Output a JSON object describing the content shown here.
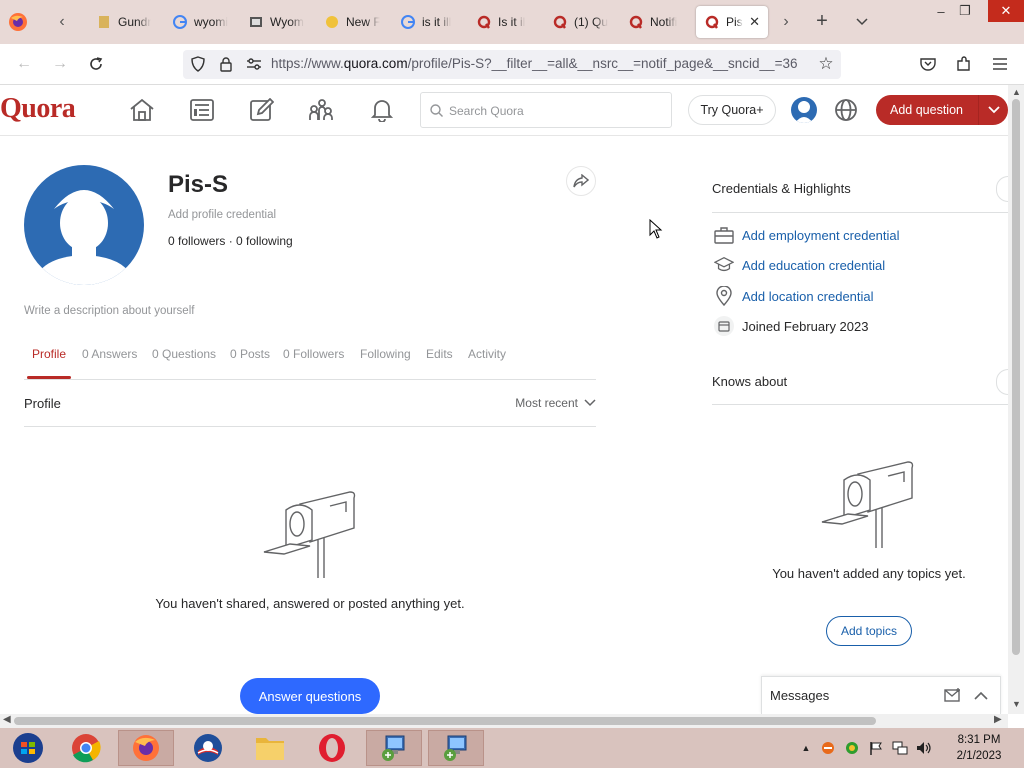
{
  "browser": {
    "tabs": [
      {
        "title": "Gundr",
        "icon": "page-icon"
      },
      {
        "title": "wyomi",
        "icon": "google-icon"
      },
      {
        "title": "Wyom",
        "icon": "page-icon"
      },
      {
        "title": "New F",
        "icon": "page-icon"
      },
      {
        "title": "is it ill",
        "icon": "google-icon"
      },
      {
        "title": "Is it il",
        "icon": "quora-icon"
      },
      {
        "title": "(1) Qu",
        "icon": "quora-icon"
      },
      {
        "title": "Notifi",
        "icon": "quora-icon"
      },
      {
        "title": "Pis-",
        "icon": "quora-icon"
      }
    ],
    "url_prefix": "https://www.",
    "url_domain": "quora.com",
    "url_rest": "/profile/Pis-S?__filter__=all&__nsrc__=notif_page&__sncid__=36"
  },
  "quora": {
    "logo": "Quora",
    "search_placeholder": "Search Quora",
    "try_plus": "Try Quora+",
    "add_question": "Add question",
    "brand_color": "#b92b27"
  },
  "profile": {
    "name": "Pis-S",
    "credential_placeholder": "Add profile credential",
    "followers_text": "0 followers · 0 following",
    "description_placeholder": "Write a description about yourself",
    "tabs": [
      "Profile",
      "0 Answers",
      "0 Questions",
      "0 Posts",
      "0 Followers",
      "Following",
      "Edits",
      "Activity"
    ],
    "section_title": "Profile",
    "sort": "Most recent",
    "empty_text": "You haven't shared, answered or posted anything yet.",
    "answer_button": "Answer questions"
  },
  "sidebar": {
    "credentials_title": "Credentials & Highlights",
    "credentials": [
      {
        "label": "Add employment credential",
        "icon": "briefcase-icon"
      },
      {
        "label": "Add education credential",
        "icon": "graduation-cap-icon"
      },
      {
        "label": "Add location credential",
        "icon": "location-pin-icon"
      },
      {
        "label": "Joined February 2023",
        "icon": "calendar-icon"
      }
    ],
    "knows_title": "Knows about",
    "empty_topics": "You haven't added any topics yet.",
    "add_topics": "Add topics",
    "messages": "Messages"
  },
  "taskbar": {
    "time": "8:31 PM",
    "date": "2/1/2023"
  }
}
